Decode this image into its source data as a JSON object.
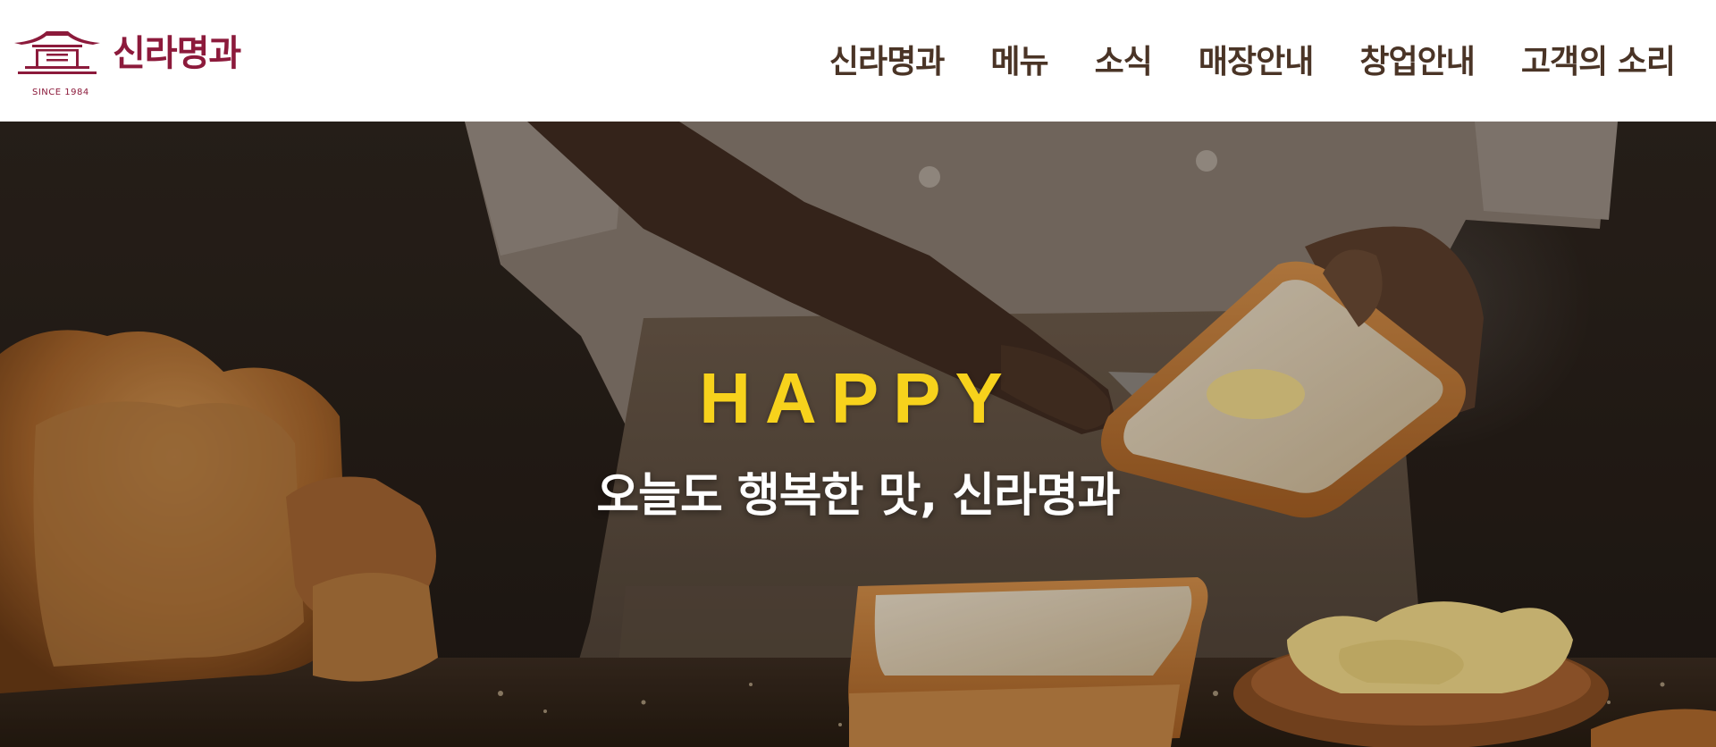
{
  "brand": {
    "name": "신라명과",
    "since": "SINCE 1984",
    "color": "#8c1a3b"
  },
  "nav": {
    "items": [
      {
        "label": "신라명과"
      },
      {
        "label": "메뉴"
      },
      {
        "label": "소식"
      },
      {
        "label": "매장안내"
      },
      {
        "label": "창업안내"
      },
      {
        "label": "고객의 소리"
      }
    ],
    "color": "#4a3426"
  },
  "hero": {
    "eyebrow": "HAPPY",
    "headline": "오늘도 행복한 맛, 신라명과",
    "eyebrow_color": "#f7d21c",
    "headline_color": "#ffffff"
  }
}
